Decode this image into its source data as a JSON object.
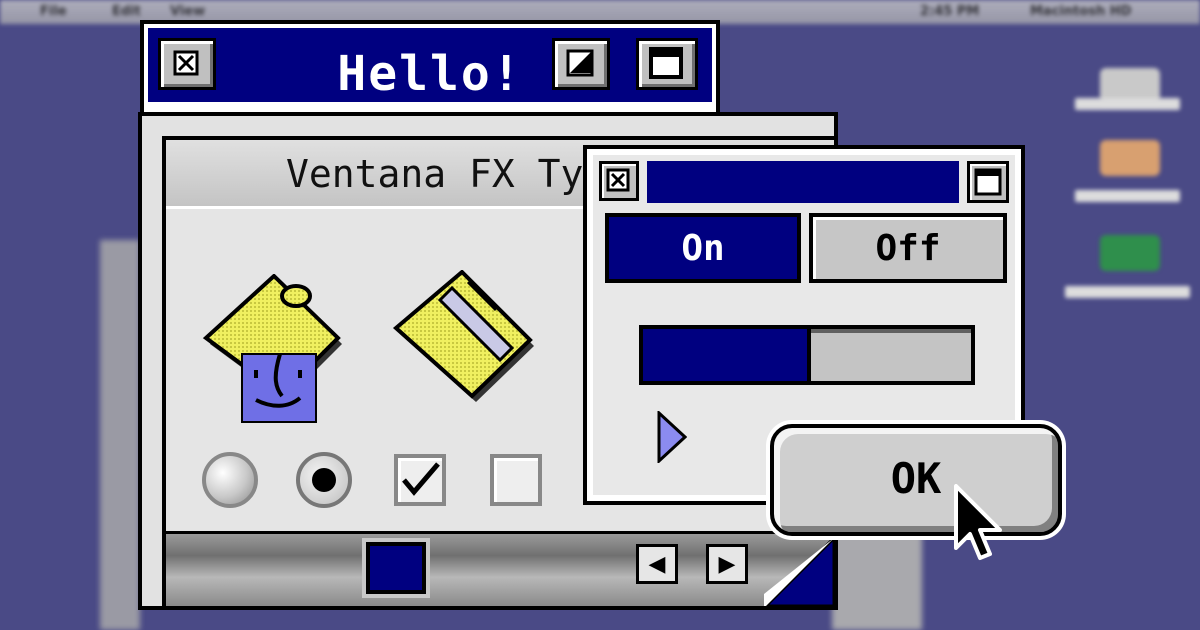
{
  "menubar": {
    "apple": "",
    "file": "File",
    "edit": "Edit",
    "view": "View",
    "clock": "2:45 PM",
    "app": "Macintosh HD"
  },
  "hello_window": {
    "title": "Hello!"
  },
  "ventana_window": {
    "title": "Ventana FX Ty"
  },
  "onoff_window": {
    "on_label": "On",
    "off_label": "Off",
    "selected": "On",
    "progress": 0.5
  },
  "controls": {
    "radio_1_checked": false,
    "radio_2_checked": true,
    "checkbox_1_checked": true,
    "checkbox_2_checked": false
  },
  "ok_button": {
    "label": "OK"
  },
  "icons": [
    "close-box-icon",
    "zoom-box-icon",
    "collapse-box-icon",
    "finder-folder-icon",
    "open-folder-icon",
    "play-arrow-icon",
    "pointer-cursor-icon"
  ],
  "colors": {
    "title_blue": "#000080",
    "desktop": "#4a4a86",
    "platinum": "#e2e2e2"
  }
}
